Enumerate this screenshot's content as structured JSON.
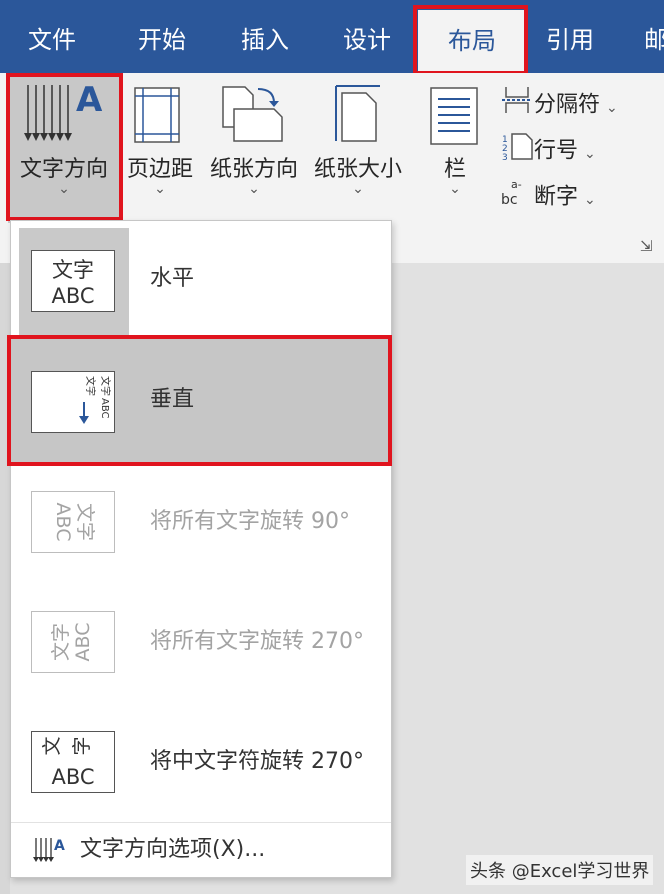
{
  "tabs": [
    {
      "label": "文件"
    },
    {
      "label": "开始"
    },
    {
      "label": "插入"
    },
    {
      "label": "设计"
    },
    {
      "label": "布局",
      "active": true
    },
    {
      "label": "引用"
    },
    {
      "label": "邮"
    }
  ],
  "ribbon": {
    "text_direction": "文字方向",
    "margins": "页边距",
    "orientation": "纸张方向",
    "size": "纸张大小",
    "columns": "栏",
    "breaks": "分隔符",
    "line_numbers": "行号",
    "hyphenation": "断字",
    "caret": "⌄",
    "launcher": "⇲"
  },
  "thumb_text": {
    "line1": "文字",
    "line2": "ABC"
  },
  "menu": {
    "items": [
      {
        "label": "水平",
        "state": "selected"
      },
      {
        "label": "垂直",
        "state": "hover"
      },
      {
        "label": "将所有文字旋转 90°",
        "state": "disabled"
      },
      {
        "label": "将所有文字旋转 270°",
        "state": "disabled"
      },
      {
        "label": "将中文字符旋转 270°",
        "state": "normal"
      }
    ],
    "footer_label": "文字方向选项(X)..."
  },
  "watermark": "头条 @Excel学习世界",
  "colors": {
    "brand": "#2b579a",
    "highlight": "#e0141e",
    "hover": "#c6c6c6"
  }
}
